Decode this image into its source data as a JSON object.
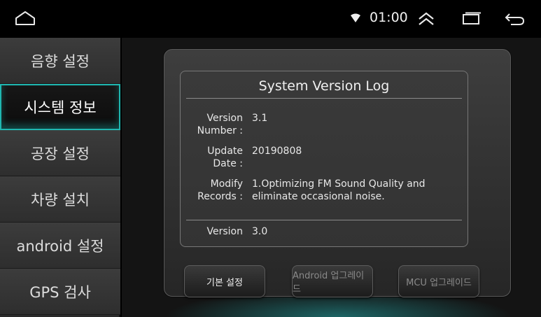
{
  "status": {
    "time": "01:00",
    "icons": [
      "home-icon",
      "wifi-icon",
      "collapse-up-icon",
      "recent-apps-icon",
      "back-icon"
    ]
  },
  "sidebar": {
    "items": [
      {
        "label": "음향 설정",
        "active": false
      },
      {
        "label": "시스템 정보",
        "active": true
      },
      {
        "label": "공장 설정",
        "active": false
      },
      {
        "label": "차량 설치",
        "active": false
      },
      {
        "label": "android 설정",
        "active": false
      },
      {
        "label": "GPS 검사",
        "active": false
      }
    ]
  },
  "log": {
    "title": "System Version Log",
    "entries": [
      {
        "label": "Version Number :",
        "value": "3.1"
      },
      {
        "label": "Update Date :",
        "value": "20190808"
      },
      {
        "label": "Modify Records :",
        "value": "1.Optimizing FM Sound Quality and eliminate occasional noise."
      },
      {
        "label": "Version",
        "value": "3.0"
      }
    ]
  },
  "buttons": {
    "basic": "기본 설정",
    "android_upgrade": "Android 업그레이드",
    "mcu_upgrade": "MCU 업그레이드"
  },
  "colors": {
    "accent": "#1fb7b0",
    "panel": "#333333",
    "background": "#141414"
  }
}
